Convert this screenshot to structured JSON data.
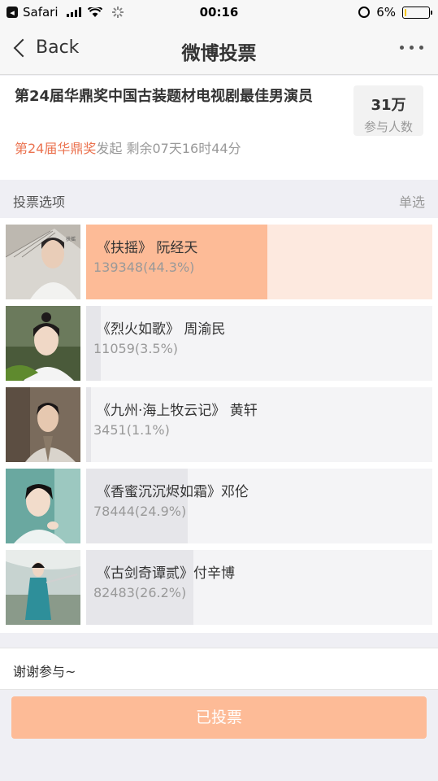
{
  "status_bar": {
    "carrier": "Safari",
    "time": "00:16",
    "battery_text": "6%",
    "battery_level": 0.06
  },
  "nav": {
    "back_label": "Back",
    "title": "微博投票"
  },
  "poll": {
    "title": "第24届华鼎奖中国古装题材电视剧最佳男演员",
    "initiator": "第24届华鼎奖",
    "initiated_text": "发起",
    "remaining_text": "剩余07天16时44分",
    "participants_count": "31万",
    "participants_label": "参与人数"
  },
  "section": {
    "label": "投票选项",
    "mode": "单选"
  },
  "options": [
    {
      "name": "《扶摇》 阮经天",
      "stat": "139348(44.3%)",
      "percent": 44.3,
      "selected": true
    },
    {
      "name": "《烈火如歌》 周渝民",
      "stat": "11059(3.5%)",
      "percent": 3.5,
      "selected": false
    },
    {
      "name": "《九州·海上牧云记》 黄轩",
      "stat": "3451(1.1%)",
      "percent": 1.1,
      "selected": false
    },
    {
      "name": "《香蜜沉沉烬如霜》邓伦",
      "stat": "78444(24.9%)",
      "percent": 24.9,
      "selected": false
    },
    {
      "name": "《古剑奇谭贰》付辛博",
      "stat": "82483(26.2%)",
      "percent": 26.2,
      "selected": false
    }
  ],
  "footer": {
    "thanks": "谢谢参与~",
    "button_label": "已投票"
  },
  "colors": {
    "accent": "#eb7350",
    "selected_bar": "#fdbb97",
    "button": "#fdbb97"
  }
}
